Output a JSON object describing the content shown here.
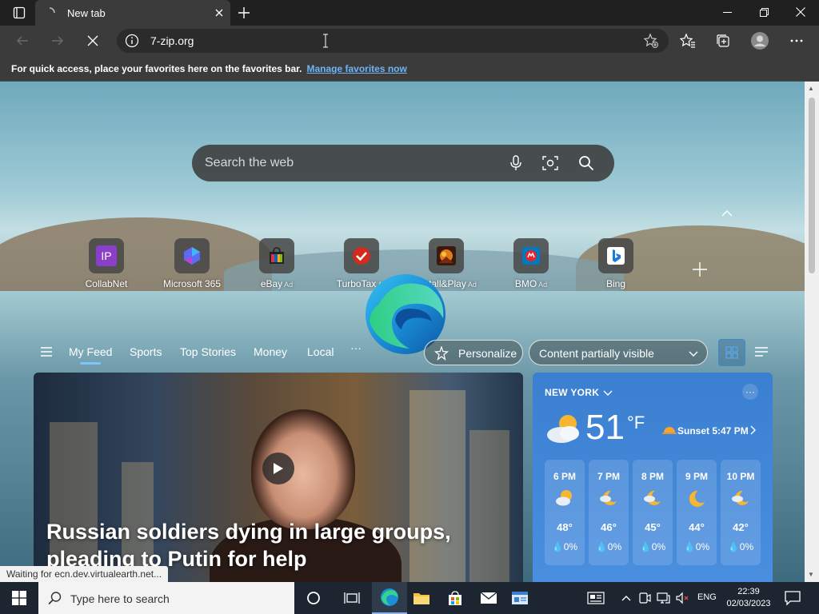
{
  "browser": {
    "tab_title": "New tab",
    "url": "7-zip.org"
  },
  "favorites_bar": {
    "message": "For quick access, place your favorites here on the favorites bar.",
    "link": "Manage favorites now"
  },
  "newtab": {
    "search_placeholder": "Search the web",
    "quick_links": [
      {
        "label": "CollabNet",
        "ad": "",
        "tile_text": "IP"
      },
      {
        "label": "Microsoft 365",
        "ad": ""
      },
      {
        "label": "eBay",
        "ad": "Ad"
      },
      {
        "label": "TurboTax",
        "ad": "Ad"
      },
      {
        "label": "Install&Play",
        "ad": "Ad"
      },
      {
        "label": "BMO",
        "ad": "Ad"
      },
      {
        "label": "Bing",
        "ad": ""
      }
    ],
    "feed_tabs": [
      "My Feed",
      "Sports",
      "Top Stories",
      "Money",
      "Local"
    ],
    "more_tabs": "···",
    "personalize": "Personalize",
    "content_visibility": "Content partially visible",
    "hero_title": "Russian soldiers dying in large groups, pleading to Putin for help",
    "weather": {
      "city": "NEW YORK",
      "temp": "51",
      "unit": "°F",
      "more": "···",
      "sunset": "Sunset 5:47 PM",
      "hourly": [
        {
          "time": "6 PM",
          "temp": "48°",
          "precip": "0%"
        },
        {
          "time": "7 PM",
          "temp": "46°",
          "precip": "0%"
        },
        {
          "time": "8 PM",
          "temp": "45°",
          "precip": "0%"
        },
        {
          "time": "9 PM",
          "temp": "44°",
          "precip": "0%"
        },
        {
          "time": "10 PM",
          "temp": "42°",
          "precip": "0%"
        }
      ]
    }
  },
  "status_tip": "Waiting for ecn.dev.virtualearth.net...",
  "taskbar": {
    "search_placeholder": "Type here to search",
    "lang": "ENG",
    "time": "22:39",
    "date": "02/03/2023"
  },
  "colors": {
    "accent_link": "#6fb4f4",
    "weather_bg": "#3a7fd0",
    "taskbar_bg": "#1c2530"
  }
}
